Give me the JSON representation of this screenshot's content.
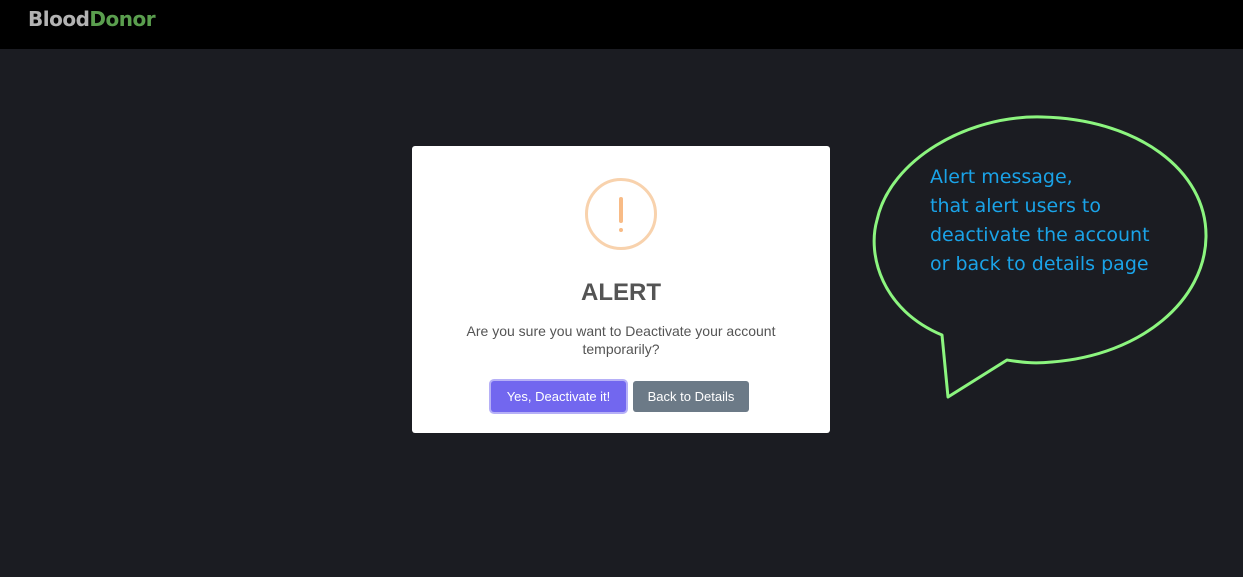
{
  "header": {
    "brand_part1": "Blood",
    "brand_part2": "Donor"
  },
  "dialog": {
    "icon": "exclamation-icon",
    "title": "ALERT",
    "message": "Are you sure you want to Deactivate your account temporarily?",
    "confirm_label": "Yes, Deactivate it!",
    "cancel_label": "Back to Details"
  },
  "annotation": {
    "text": "Alert message,\nthat  alert users to\ndeactivate the account\nor back to details page"
  },
  "colors": {
    "background": "#1b1c22",
    "topbar": "#000000",
    "brand_grey": "#b3b3b3",
    "brand_green": "#5a9e4e",
    "confirm_button": "#7267ef",
    "cancel_button": "#6c7a87",
    "warning_icon": "#f8bb86",
    "annotation_outline": "#8cf57f",
    "annotation_text": "#1aa3e8"
  }
}
